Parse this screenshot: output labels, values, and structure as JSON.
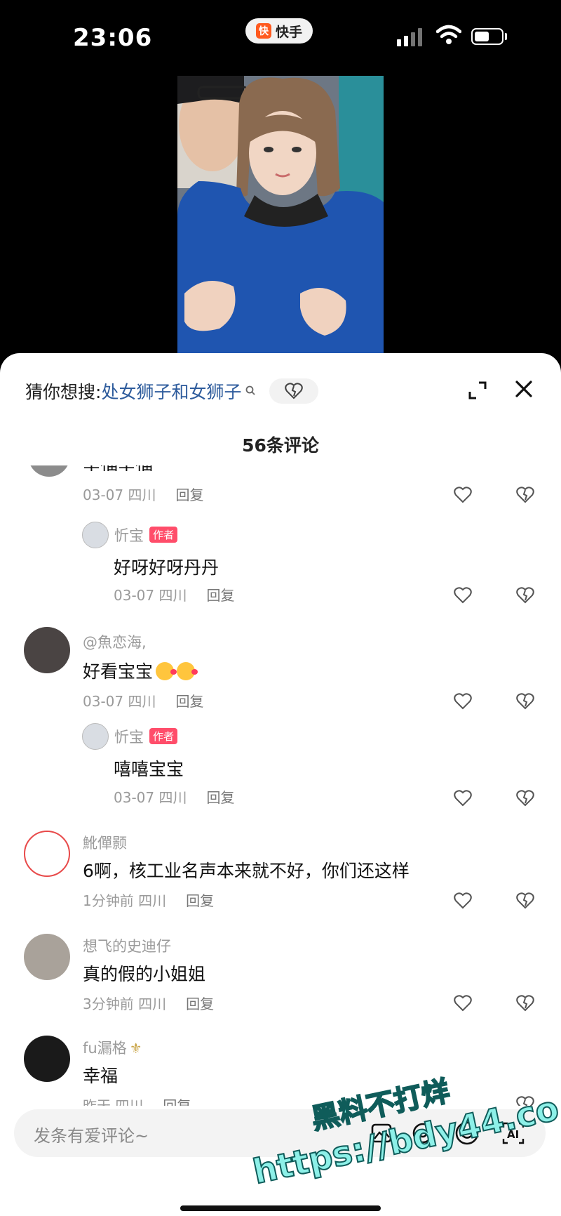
{
  "status_bar": {
    "time": "23:06",
    "app_name": "快手",
    "app_logo": "快"
  },
  "search_suggest": {
    "prefix": "猜你想搜:",
    "term": "处女狮子和女狮子"
  },
  "comment_count": "56条评论",
  "comments": [
    {
      "id": "c0",
      "text": "幸福幸福",
      "meta": "03-07 四川",
      "reply": "回复"
    },
    {
      "id": "c1",
      "name": "忻宝",
      "badge": "作者",
      "text": "好呀好呀丹丹",
      "meta": "03-07 四川",
      "reply": "回复"
    },
    {
      "id": "c2",
      "name": "@魚恋海,",
      "text": "好看宝宝",
      "meta": "03-07 四川",
      "reply": "回复"
    },
    {
      "id": "c3",
      "name": "忻宝",
      "badge": "作者",
      "text": "嘻嘻宝宝",
      "meta": "03-07 四川",
      "reply": "回复"
    },
    {
      "id": "c4",
      "name": "魤僤颢",
      "text": "6啊，核工业名声本来就不好，你们还这样",
      "meta": "1分钟前 四川",
      "reply": "回复"
    },
    {
      "id": "c5",
      "name": "想飞的史迪仔",
      "text": "真的假的小姐姐",
      "meta": "3分钟前 四川",
      "reply": "回复"
    },
    {
      "id": "c6",
      "name": "fu漏格",
      "text": "幸福",
      "meta": "昨天 四川",
      "reply": "回复"
    }
  ],
  "input": {
    "placeholder": "发条有爱评论~"
  },
  "watermark": {
    "line1": "黑料不打烊",
    "line2": "https://bdy44.co"
  },
  "icons": [
    "app-logo-icon",
    "signal-icon",
    "wifi-icon",
    "battery-icon",
    "search-small-icon",
    "heart-broken-icon",
    "expand-icon",
    "close-icon",
    "heart-icon",
    "image-icon",
    "at-icon",
    "emoji-icon",
    "ai-icon"
  ]
}
